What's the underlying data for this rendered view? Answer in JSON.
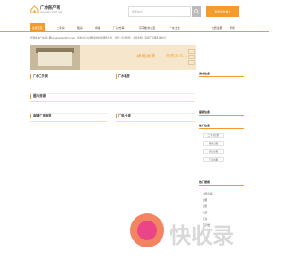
{
  "header": {
    "logo_text": "广水房产网",
    "logo_sub": "guangshui.fzm.net",
    "search_placeholder": "搜索信息",
    "post_button": "免费发布信息"
  },
  "nav": {
    "items": [
      "房屋首页",
      "二手房",
      "租房",
      "商铺",
      "厂房/仓库",
      "写字楼/办公室",
      "广水土地"
    ],
    "right": [
      "免费注册",
      "登录"
    ]
  },
  "intro": "您现在的广水房产网(guangshui.fzm.net)，您在这可以免费发布房屋租售信息，包括二手房出售、房屋出租、商铺厂房租售等信息。",
  "banner": {
    "text1": "出租出售",
    "text2": "免费发布..."
  },
  "boxes": {
    "b1": "广水二手房",
    "b2": "广水租房",
    "b3": "图片/房源",
    "b4": "商铺/厂房租赁",
    "b5": "厂房/仓库"
  },
  "sidebar": {
    "s1_title": "发布信息",
    "s2_title": "最新信息",
    "s3_title": "热门信息",
    "s3_items": [
      "二手房出售",
      "租房出租",
      "商铺出租",
      "厂房出租"
    ],
    "s4_title": "热门搜索",
    "s4_items": [
      "小区房屋",
      "出租",
      "出售",
      "商铺",
      "厂房",
      "写字楼"
    ]
  },
  "watermark": {
    "text": "快收录"
  },
  "colors": {
    "accent": "#f39c2b"
  }
}
